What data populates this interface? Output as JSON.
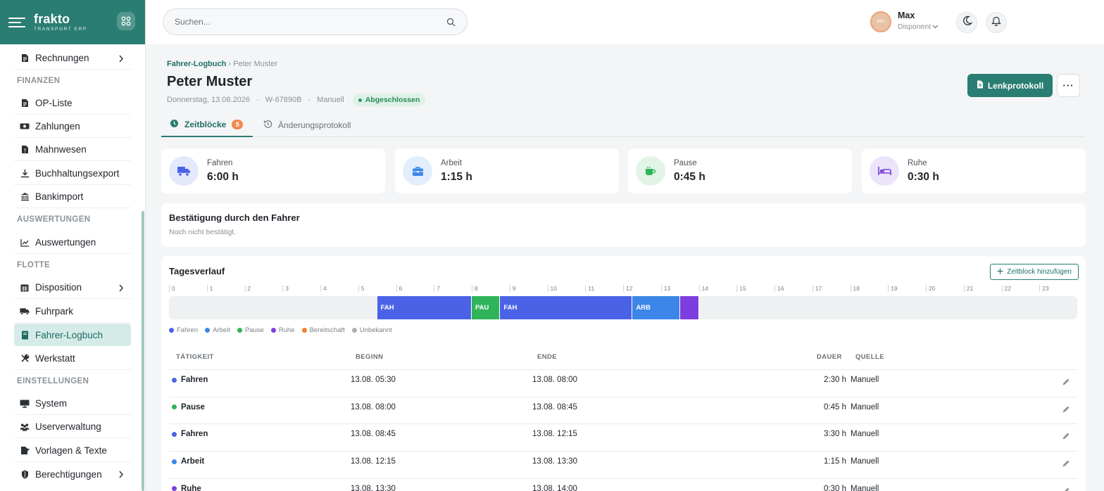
{
  "brand": {
    "name": "frakto",
    "tagline": "TRANSPORT ERP"
  },
  "search": {
    "placeholder": "Suchen..."
  },
  "user": {
    "name": "Max",
    "role": "Disponent",
    "avatar_text": "MAX"
  },
  "sidebar": {
    "items": [
      {
        "label": "Rechnungen",
        "icon": "document-icon",
        "chevron": true
      },
      {
        "section": "FINANZEN"
      },
      {
        "label": "OP-Liste",
        "icon": "document-icon"
      },
      {
        "label": "Zahlungen",
        "icon": "money-icon"
      },
      {
        "label": "Mahnwesen",
        "icon": "document-alert-icon"
      },
      {
        "label": "Buchhaltungsexport",
        "icon": "download-icon"
      },
      {
        "label": "Bankimport",
        "icon": "bank-icon"
      },
      {
        "section": "AUSWERTUNGEN"
      },
      {
        "label": "Auswertungen",
        "icon": "chart-line-icon"
      },
      {
        "section": "FLOTTE"
      },
      {
        "label": "Disposition",
        "icon": "calendar-icon",
        "chevron": true
      },
      {
        "label": "Fuhrpark",
        "icon": "truck-icon"
      },
      {
        "label": "Fahrer-Logbuch",
        "icon": "book-icon",
        "active": true
      },
      {
        "label": "Werkstatt",
        "icon": "wrench-icon"
      },
      {
        "section": "EINSTELLUNGEN"
      },
      {
        "label": "System",
        "icon": "monitor-icon"
      },
      {
        "label": "Userverwaltung",
        "icon": "users-icon"
      },
      {
        "label": "Vorlagen & Texte",
        "icon": "file-edit-icon"
      },
      {
        "label": "Berechtigungen",
        "icon": "shield-icon",
        "chevron": true
      }
    ]
  },
  "breadcrumb": {
    "parent": "Fahrer-Logbuch",
    "separator": "›",
    "current": "Peter Muster"
  },
  "page": {
    "title": "Peter Muster",
    "date": "Donnerstag, 13.08.2026",
    "vehicle": "W-67890B",
    "source": "Manuell",
    "status": "Abgeschlossen",
    "meta_separator": "·"
  },
  "actions": {
    "primary_label": "Lenkprotokoll",
    "more_label": "···"
  },
  "tabs": [
    {
      "label": "Zeitblöcke",
      "count": "5",
      "active": true
    },
    {
      "label": "Änderungsprotokoll"
    }
  ],
  "stats": [
    {
      "label": "Fahren",
      "value": "6:00 h",
      "icon": "truck-icon",
      "color": "#4a63e6",
      "bg": "#e4e8fb"
    },
    {
      "label": "Arbeit",
      "value": "1:15 h",
      "icon": "briefcase-icon",
      "color": "#3b86e8",
      "bg": "#e3eefc"
    },
    {
      "label": "Pause",
      "value": "0:45 h",
      "icon": "coffee-icon",
      "color": "#2fb45a",
      "bg": "#e2f4e7"
    },
    {
      "label": "Ruhe",
      "value": "0:30 h",
      "icon": "bed-icon",
      "color": "#7c3ee0",
      "bg": "#ece4fa"
    }
  ],
  "confirmation": {
    "title": "Bestätigung durch den Fahrer",
    "text": "Noch nicht bestätigt."
  },
  "timeline": {
    "title": "Tagesverlauf",
    "add_label": "Zeitblock hinzufügen",
    "hours": [
      "0",
      "1",
      "2",
      "3",
      "4",
      "5",
      "6",
      "7",
      "8",
      "9",
      "10",
      "11",
      "12",
      "13",
      "14",
      "15",
      "16",
      "17",
      "18",
      "19",
      "20",
      "21",
      "22",
      "23"
    ],
    "segments": [
      {
        "label": "FAH",
        "start": 5.5,
        "end": 8.0,
        "color": "#4a63e6"
      },
      {
        "label": "PAU",
        "start": 8.0,
        "end": 8.75,
        "color": "#2fb45a"
      },
      {
        "label": "FAH",
        "start": 8.75,
        "end": 12.25,
        "color": "#4a63e6"
      },
      {
        "label": "ARB",
        "start": 12.25,
        "end": 13.5,
        "color": "#3b86e8"
      },
      {
        "label": "",
        "start": 13.5,
        "end": 14.0,
        "color": "#7c3ee0"
      }
    ],
    "legend": [
      {
        "label": "Fahren",
        "color": "#4a63e6"
      },
      {
        "label": "Arbeit",
        "color": "#3b86e8"
      },
      {
        "label": "Pause",
        "color": "#2fb45a"
      },
      {
        "label": "Ruhe",
        "color": "#7c3ee0"
      },
      {
        "label": "Bereitschaft",
        "color": "#f07f2e"
      },
      {
        "label": "Unbekannt",
        "color": "#a9aeb2"
      }
    ]
  },
  "table": {
    "headers": {
      "activity": "TÄTIGKEIT",
      "start": "BEGINN",
      "end": "ENDE",
      "duration": "DAUER",
      "source": "QUELLE"
    },
    "rows": [
      {
        "activity": "Fahren",
        "color": "#4a63e6",
        "start": "13.08. 05:30",
        "end": "13.08. 08:00",
        "duration": "2:30 h",
        "source": "Manuell"
      },
      {
        "activity": "Pause",
        "color": "#2fb45a",
        "start": "13.08. 08:00",
        "end": "13.08. 08:45",
        "duration": "0:45 h",
        "source": "Manuell"
      },
      {
        "activity": "Fahren",
        "color": "#4a63e6",
        "start": "13.08. 08:45",
        "end": "13.08. 12:15",
        "duration": "3:30 h",
        "source": "Manuell"
      },
      {
        "activity": "Arbeit",
        "color": "#3b86e8",
        "start": "13.08. 12:15",
        "end": "13.08. 13:30",
        "duration": "1:15 h",
        "source": "Manuell"
      },
      {
        "activity": "Ruhe",
        "color": "#7c3ee0",
        "start": "13.08. 13:30",
        "end": "13.08. 14:00",
        "duration": "0:30 h",
        "source": "Manuell"
      }
    ]
  }
}
